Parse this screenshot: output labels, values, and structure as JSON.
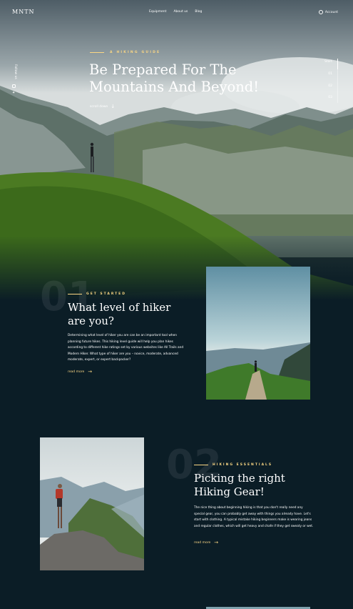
{
  "nav": {
    "logo": "MNTN",
    "links": [
      "Equipment",
      "About us",
      "Blog"
    ],
    "account": "Account"
  },
  "social": {
    "follow_label": "Follow us"
  },
  "hero": {
    "eyebrow": "A HIKING GUIDE",
    "title": "Be Prepared For The Mountains And Beyond!",
    "scroll_label": "scroll down"
  },
  "side_nav": {
    "items": [
      "Start",
      "01",
      "02",
      "03"
    ]
  },
  "sections": [
    {
      "number": "01",
      "eyebrow": "GET STARTED",
      "title": "What level of hiker are you?",
      "body": "Determining what level of hiker you are can be an important tool when planning future hikes. This hiking level guide will help you plan hikes according to different hike ratings set by various websites like All Trails and Modern Hiker. What type of hiker are you – novice, moderate, advanced moderate, expert, or expert backpacker?",
      "link": "read more"
    },
    {
      "number": "02",
      "eyebrow": "HIKING ESSENTIALS",
      "title": "Picking the right Hiking Gear!",
      "body": "The nice thing about beginning hiking is that you don't really need any special gear, you can probably get away with things you already have. Let's start with clothing. A typical mistake hiking beginners make is wearing jeans and regular clothes, which will get heavy and chafe if they get sweaty or wet.",
      "link": "read more"
    }
  ],
  "colors": {
    "accent": "#fbd784",
    "background": "#0b1d26"
  }
}
